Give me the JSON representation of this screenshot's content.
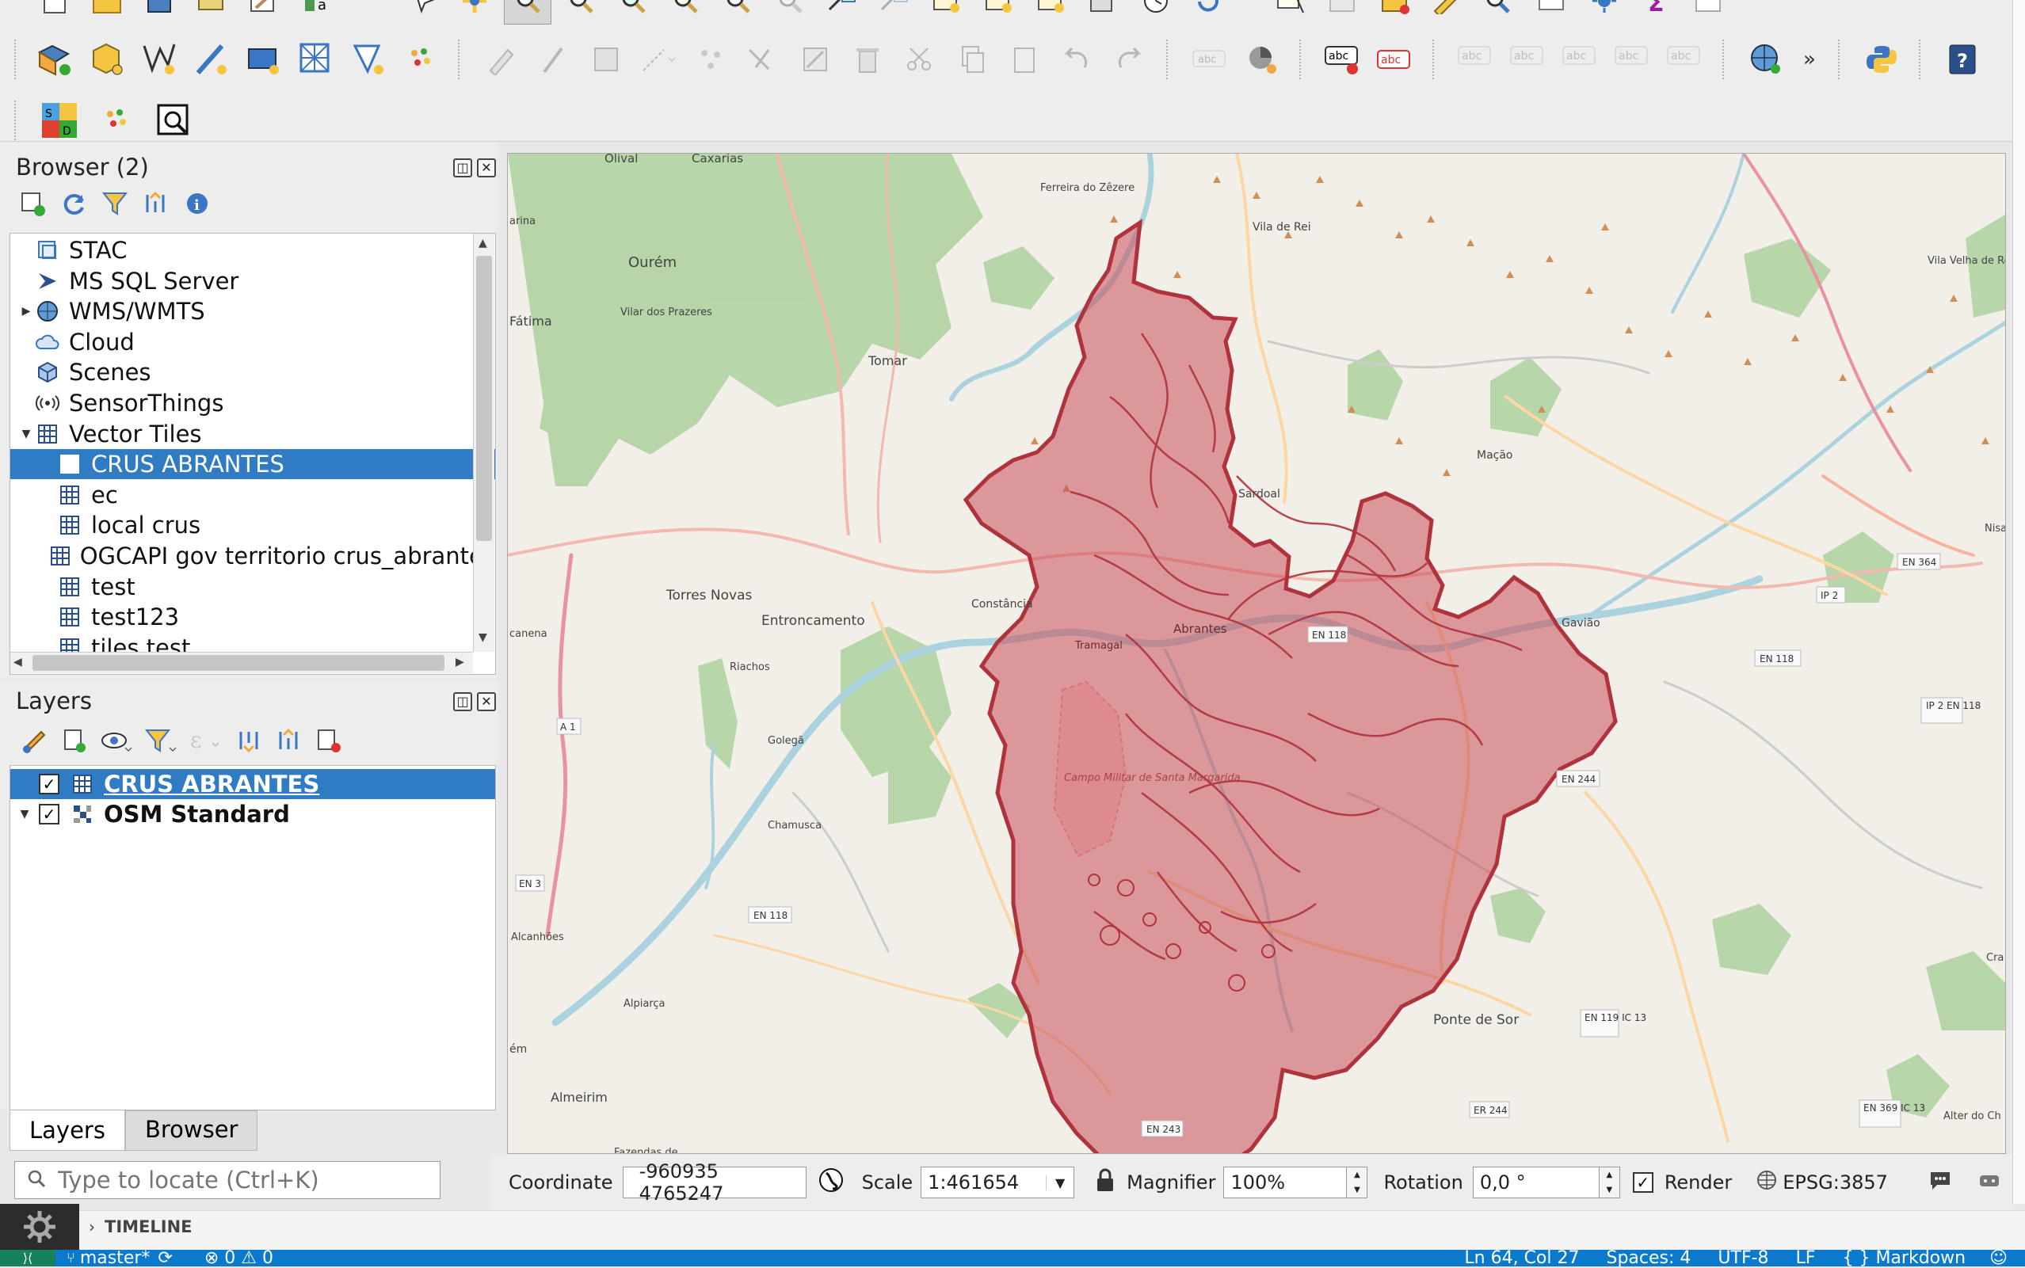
{
  "colors": {
    "selection": "#2f7bc4",
    "layer_fill": "#c2464f",
    "vscode_status": "#0b7acc",
    "map_bg": "#f2efe9",
    "forest": "#add19e"
  },
  "icons": {
    "row1": [
      "new-project-icon",
      "open-project-icon",
      "save-project-icon",
      "print-layout-icon",
      "layout-manager-icon",
      "style-manager-icon",
      "pan-map-icon",
      "pan-to-selection-icon",
      "zoom-in-icon",
      "zoom-out-icon",
      "zoom-full-icon",
      "zoom-to-selection-icon",
      "zoom-to-layer-icon",
      "zoom-native-icon",
      "zoom-last-icon",
      "zoom-next-icon",
      "new-map-view-icon",
      "temporal-controller-icon",
      "refresh-icon",
      "identify-icon",
      "select-feature-icon",
      "deselect-icon",
      "open-attribute-table-icon",
      "field-calculator-icon",
      "statistics-icon",
      "measure-icon",
      "annotation-icon",
      "map-tips-icon",
      "bookmark-icon",
      "show-bookmarks-icon",
      "script-icon"
    ],
    "row2": [
      "data-source-manager-icon",
      "new-geopackage-layer-icon",
      "new-shapefile-layer-icon",
      "new-scratch-layer-icon",
      "new-virtual-layer-icon",
      "new-mesh-layer-icon",
      "new-gpx-layer-icon",
      "new-temporary-layer-icon",
      "digitize-icon",
      "toggle-editing-icon",
      "save-edits-icon",
      "add-feature-icon",
      "vertex-tool-icon",
      "node-tool-icon",
      "modify-attributes-icon",
      "delete-selected-icon",
      "cut-features-icon",
      "copy-features-icon",
      "paste-features-icon",
      "undo-icon",
      "redo-icon",
      "label-toolbar-icon",
      "layer-diagram-icon",
      "label-abc-icon",
      "label-abc-red-icon",
      "pin-label-icon",
      "show-hide-labels-icon",
      "move-label-icon",
      "rotate-label-icon",
      "change-label-icon",
      "metasearch-icon",
      "more-icon",
      "python-icon",
      "help-icon"
    ],
    "row3": [
      "sld-icon",
      "point-cluster-icon",
      "locator-magnifier-icon"
    ]
  },
  "browser": {
    "title": "Browser (2)",
    "toolbar": [
      "add-selected-layers-icon",
      "refresh-icon",
      "filter-icon",
      "collapse-all-icon",
      "properties-icon"
    ],
    "items": [
      {
        "label": "STAC",
        "icon": "stac-icon",
        "indent": 0,
        "arrow": ""
      },
      {
        "label": "MS SQL Server",
        "icon": "mssql-icon",
        "indent": 0,
        "arrow": ""
      },
      {
        "label": "WMS/WMTS",
        "icon": "globe-icon",
        "indent": 0,
        "arrow": "▶"
      },
      {
        "label": "Cloud",
        "icon": "cloud-icon",
        "indent": 0,
        "arrow": ""
      },
      {
        "label": "Scenes",
        "icon": "cube-icon",
        "indent": 0,
        "arrow": ""
      },
      {
        "label": "SensorThings",
        "icon": "sensor-icon",
        "indent": 0,
        "arrow": ""
      },
      {
        "label": "Vector Tiles",
        "icon": "vector-tile-icon",
        "indent": 0,
        "arrow": "▼"
      },
      {
        "label": "CRUS ABRANTES",
        "icon": "vector-tile-icon",
        "indent": 1,
        "arrow": "",
        "selected": true
      },
      {
        "label": "ec",
        "icon": "vector-tile-icon",
        "indent": 1,
        "arrow": ""
      },
      {
        "label": "local crus",
        "icon": "vector-tile-icon",
        "indent": 1,
        "arrow": ""
      },
      {
        "label": "OGCAPI gov territorio crus_abrantes",
        "icon": "vector-tile-icon",
        "indent": 1,
        "arrow": ""
      },
      {
        "label": "test",
        "icon": "vector-tile-icon",
        "indent": 1,
        "arrow": ""
      },
      {
        "label": "test123",
        "icon": "vector-tile-icon",
        "indent": 1,
        "arrow": ""
      },
      {
        "label": "tiles test",
        "icon": "vector-tile-icon",
        "indent": 1,
        "arrow": ""
      }
    ]
  },
  "layers": {
    "title": "Layers",
    "toolbar": [
      "style-icon",
      "add-group-icon",
      "manage-visibility-icon",
      "filter-legend-icon",
      "filter-expression-icon",
      "expand-all-icon",
      "collapse-all-icon",
      "remove-layer-icon"
    ],
    "items": [
      {
        "label": "CRUS ABRANTES",
        "checked": true,
        "selected": true,
        "arrow": ""
      },
      {
        "label": "OSM Standard",
        "checked": true,
        "selected": false,
        "arrow": "▼"
      }
    ]
  },
  "tabs": [
    "Layers",
    "Browser"
  ],
  "locator": {
    "placeholder": "Type to locate (Ctrl+K)"
  },
  "status": {
    "coordinate_label": "Coordinate",
    "coordinate_value": "-960935  4765247",
    "scale_label": "Scale",
    "scale_value": "1:461654",
    "magnifier_label": "Magnifier",
    "magnifier_value": "100%",
    "rotation_label": "Rotation",
    "rotation_value": "0,0 °",
    "render_label": "Render",
    "render_checked": true,
    "crs": "EPSG:3857"
  },
  "timeline": {
    "label": "TIMELINE"
  },
  "vscode": {
    "branch": "master*",
    "problems": "⊗ 0 ⚠ 0",
    "cursor": "Ln 64, Col 27",
    "spaces": "Spaces: 4",
    "encoding": "UTF-8",
    "eol": "LF",
    "language": "{ } Markdown"
  },
  "map": {
    "places": [
      {
        "name": "Olival"
      },
      {
        "name": "Caxarias"
      },
      {
        "name": "Ferreira do Zêzere"
      },
      {
        "name": "Vila de Rei"
      },
      {
        "name": "Ourém"
      },
      {
        "name": "Vilar dos Prazeres"
      },
      {
        "name": "Fátima"
      },
      {
        "name": "Tomar"
      },
      {
        "name": "Vila Velha de Ródão"
      },
      {
        "name": "Mação"
      },
      {
        "name": "Sardoal"
      },
      {
        "name": "Torres Novas"
      },
      {
        "name": "Entroncamento"
      },
      {
        "name": "Constância"
      },
      {
        "name": "Gavião"
      },
      {
        "name": "Riachos"
      },
      {
        "name": "Golegã"
      },
      {
        "name": "Campo Militar de Santa Margarida"
      },
      {
        "name": "Chamusca"
      },
      {
        "name": "Alcanhões"
      },
      {
        "name": "Alpiarça"
      },
      {
        "name": "Ponte de Sor"
      },
      {
        "name": "Almeirim"
      },
      {
        "name": "Fazendas de"
      },
      {
        "name": "Alter do Ch"
      },
      {
        "name": "Nisa"
      },
      {
        "name": "Cra"
      },
      {
        "name": "arina"
      },
      {
        "name": "canena"
      },
      {
        "name": "ém"
      },
      {
        "name": "Abrantes"
      },
      {
        "name": "Tramagal"
      }
    ],
    "shields": [
      "EN 364",
      "IP 2",
      "EN 118",
      "IP 2 EN 118",
      "EN 244",
      "A 1",
      "EN 3",
      "EN 118",
      "EN 119 IC 13",
      "ER 244",
      "EN 369 IC 13",
      "EN 243",
      "EN 118"
    ]
  }
}
